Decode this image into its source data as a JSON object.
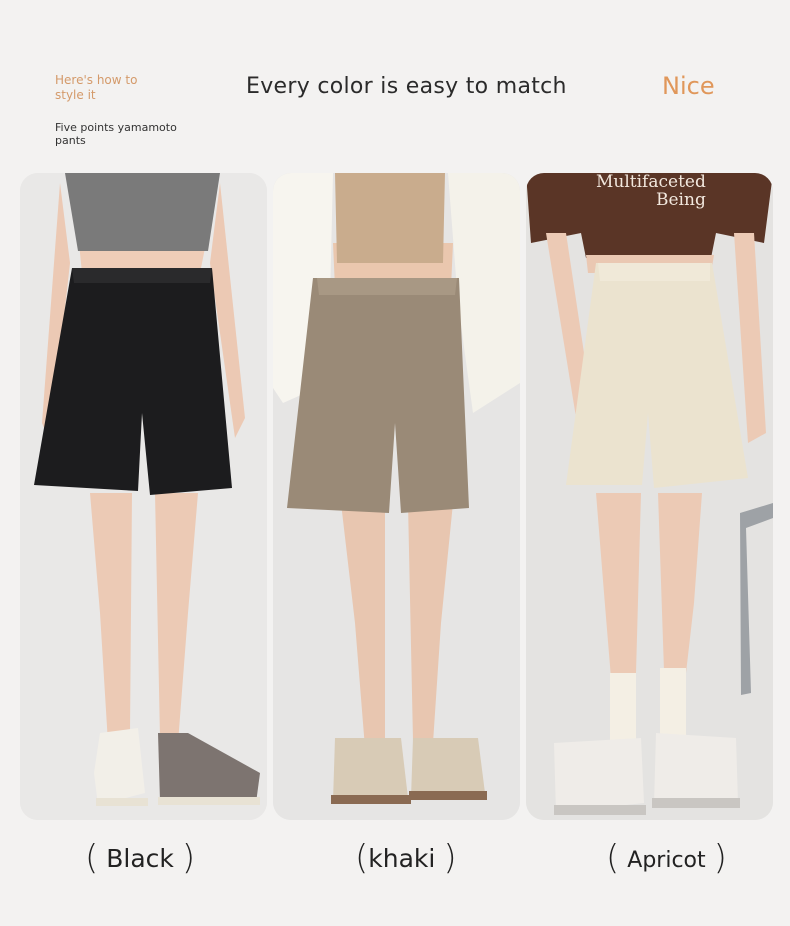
{
  "header": {
    "tip_line1": "Here's how to",
    "tip_line2": "style it",
    "subtitle_line1": "Five points yamamoto",
    "subtitle_line2": "pants",
    "title": "Every color is easy to match",
    "accent": "Nice"
  },
  "panels": [
    {
      "color_label": "Black",
      "shorts_color": "#1c1c1e",
      "top_color": "#6b6b6b",
      "shoe": "canvas-high-top"
    },
    {
      "color_label": "khaki",
      "shorts_color": "#9a8a77",
      "top_color": "#c9ac8d",
      "shoe": "khaki-sneaker"
    },
    {
      "color_label": "Apricot",
      "shorts_color": "#ebe3cf",
      "top_color": "#5a3526",
      "shoe": "chunky-sneaker"
    }
  ],
  "shirt_print": {
    "line1": "Multifaceted",
    "line2": "Being"
  },
  "colors": {
    "accent_orange": "#e0975a",
    "tip_orange": "#d49a6a",
    "background": "#f3f2f1"
  }
}
